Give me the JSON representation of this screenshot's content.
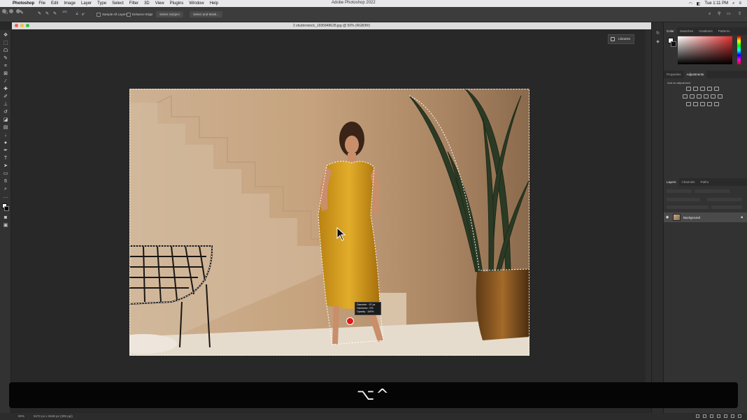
{
  "menubar": {
    "app_name": "Photoshop",
    "items": [
      "File",
      "Edit",
      "Image",
      "Layer",
      "Type",
      "Select",
      "Filter",
      "3D",
      "View",
      "Plugins",
      "Window",
      "Help"
    ],
    "window_title": "Adobe Photoshop 2022",
    "clock": "Tue 1:11 PM"
  },
  "options": {
    "brush_size": "122",
    "angle": "0°",
    "sample_all_layers": "Sample All Layers",
    "enhance_edge": "Enhance Edge",
    "select_subject": "Select Subject",
    "select_and_mask": "Select and Mask..."
  },
  "document": {
    "tab_title": "3 shutterstock_1695848628.jpg @ 50% (RGB/8#)",
    "libraries_label": "Libraries"
  },
  "brush_tooltip": {
    "diameter": "Diameter : 97 px",
    "hardness": "Hardness :   0%",
    "opacity": "Opacity : 100%"
  },
  "panels": {
    "color_tabs": [
      "Color",
      "Swatches",
      "Gradients",
      "Patterns"
    ],
    "adjust_tabs": [
      "Properties",
      "Adjustments"
    ],
    "add_adjustment": "Add an adjustment",
    "layer_tabs": [
      "Layers",
      "Channels",
      "Paths"
    ],
    "layer_name": "Background"
  },
  "statusbar": {
    "zoom": "50%",
    "dimensions": "5472 px x 3648 px (300 ppi)"
  },
  "keystroke": {
    "keys": "⌥^"
  },
  "colors": {
    "dress": "#d9a21c",
    "wall": "#c9a887",
    "brush_cursor": "#e01818"
  }
}
